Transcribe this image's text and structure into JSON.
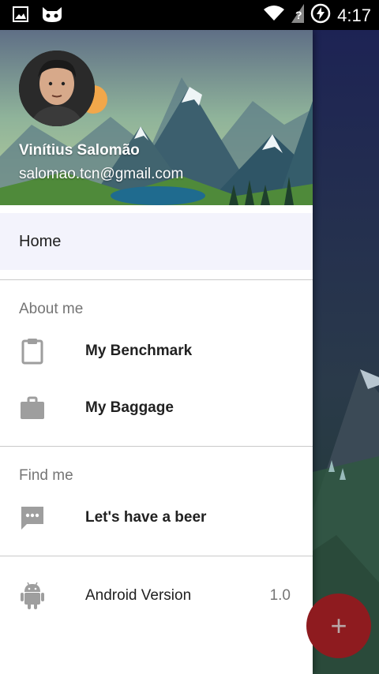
{
  "status_bar": {
    "time": "4:17",
    "icons": [
      "image-icon",
      "cat-icon",
      "wifi-icon",
      "no-signal-icon",
      "battery-charging-icon"
    ]
  },
  "drawer": {
    "user": {
      "name": "Vinítius Salomão",
      "email": "salomao.tcn@gmail.com"
    },
    "home_label": "Home",
    "sections": {
      "about": {
        "title": "About me",
        "items": [
          {
            "label": "My Benchmark",
            "icon": "clipboard-icon"
          },
          {
            "label": "My Baggage",
            "icon": "briefcase-icon"
          }
        ]
      },
      "find": {
        "title": "Find me",
        "items": [
          {
            "label": "Let's have a beer",
            "icon": "chat-icon"
          }
        ]
      },
      "android": {
        "label": "Android Version",
        "value": "1.0",
        "icon": "android-icon"
      }
    }
  },
  "fab": {
    "symbol": "+"
  },
  "colors": {
    "accent": "#c62828",
    "home_bg": "#f3f3fc",
    "icon_gray": "#9e9e9e"
  }
}
